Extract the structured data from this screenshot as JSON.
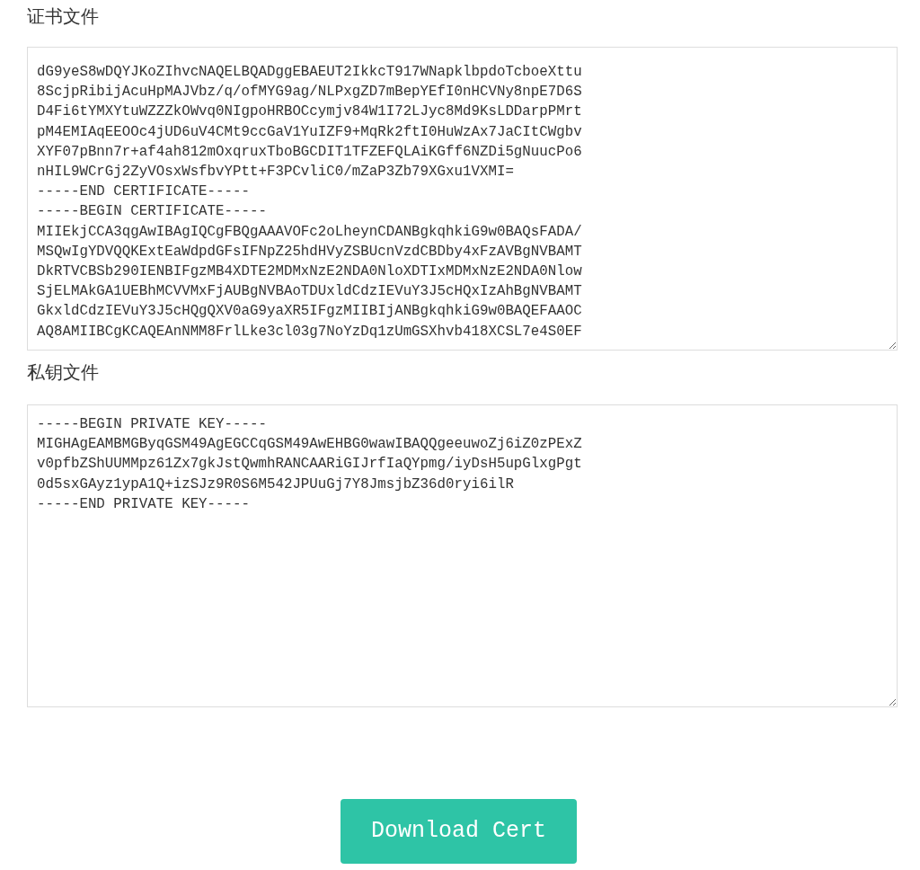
{
  "certificate": {
    "label": "证书文件",
    "lines": [
      "dG9yeS8wDQYJKoZIhvcNAQELBQADggEBAEUT2IkkcT917WNapklbpdoTcboeXttu",
      "8ScjpRibijAcuHpMAJVbz/q/ofMYG9ag/NLPxgZD7mBepYEfI0nHCVNy8npE7D6S",
      "D4Fi6tYMXYtuWZZZkOWvq0NIgpoHRBOCcymjv84W1I72LJyc8Md9KsLDDarpPMrt",
      "pM4EMIAqEEOOc4jUD6uV4CMt9ccGaV1YuIZF9+MqRk2ftI0HuWzAx7JaCItCWgbv",
      "XYF07pBnn7r+af4ah812mOxqruxTboBGCDIT1TFZEFQLAiKGff6NZDi5gNuucPo6",
      "nHIL9WCrGj2ZyVOsxWsfbvYPtt+F3PCvliC0/mZaP3Zb79XGxu1VXMI=",
      "-----END CERTIFICATE-----",
      "-----BEGIN CERTIFICATE-----",
      "MIIEkjCCA3qgAwIBAgIQCgFBQgAAAVOFc2oLheynCDANBgkqhkiG9w0BAQsFADA/",
      "MSQwIgYDVQQKExtEaWdpdGFsIFNpZ25hdHVyZSBUcnVzdCBDby4xFzAVBgNVBAMT",
      "DkRTVCBSb290IENBIFgzMB4XDTE2MDMxNzE2NDA0NloXDTIxMDMxNzE2NDA0Nlow",
      "SjELMAkGA1UEBhMCVVMxFjAUBgNVBAoTDUxldCdzIEVuY3J5cHQxIzAhBgNVBAMT",
      "GkxldCdzIEVuY3J5cHQgQXV0aG9yaXR5IFgzMIIBIjANBgkqhkiG9w0BAQEFAAOC",
      "AQ8AMIIBCgKCAQEAnNMM8FrlLke3cl03g7NoYzDq1zUmGSXhvb418XCSL7e4S0EF"
    ]
  },
  "private_key": {
    "label": "私钥文件",
    "lines": [
      "-----BEGIN PRIVATE KEY-----",
      "MIGHAgEAMBMGByqGSM49AgEGCCqGSM49AwEHBG0wawIBAQQgeeuwoZj6iZ0zPExZ",
      "v0pfbZShUUMMpz61Zx7gkJstQwmhRANCAARiGIJrfIaQYpmg/iyDsH5upGlxgPgt",
      "0d5sxGAyz1ypA1Q+izSJz9R0S6M542JPUuGj7Y8JmsjbZ36d0ryi6ilR",
      "-----END PRIVATE KEY-----"
    ]
  },
  "download_button": "Download Cert"
}
